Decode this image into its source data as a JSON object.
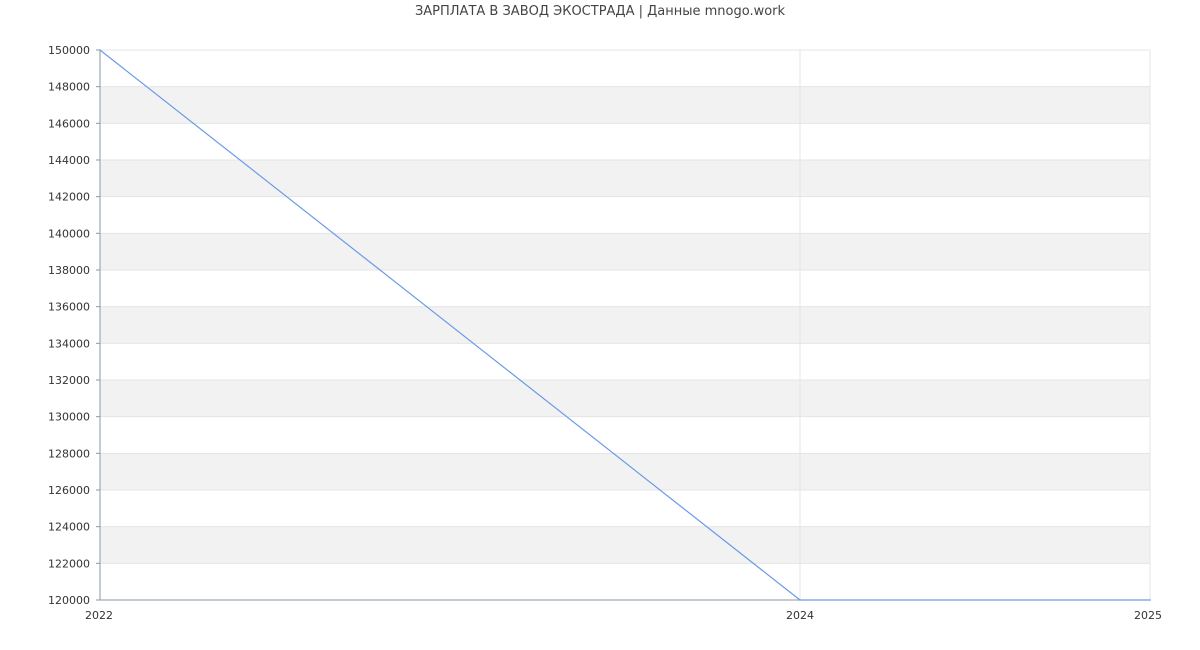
{
  "chart_data": {
    "type": "line",
    "title": "ЗАРПЛАТА В ЗАВОД ЭКОСТРАДА | Данные mnogo.work",
    "x": [
      2022,
      2024,
      2025
    ],
    "x_ticks": [
      "2022",
      "2024",
      "2025"
    ],
    "xlim": [
      2022,
      2025
    ],
    "ylim": [
      120000,
      150000
    ],
    "y_ticks": [
      "120000",
      "122000",
      "124000",
      "126000",
      "128000",
      "130000",
      "132000",
      "134000",
      "136000",
      "138000",
      "140000",
      "142000",
      "144000",
      "146000",
      "148000",
      "150000"
    ],
    "series": [
      {
        "values": [
          150000,
          120000,
          120000
        ],
        "color": "#6a9be8"
      }
    ],
    "grid": true,
    "band_color": "#f2f2f2",
    "axis_color": "#8a98a6"
  }
}
